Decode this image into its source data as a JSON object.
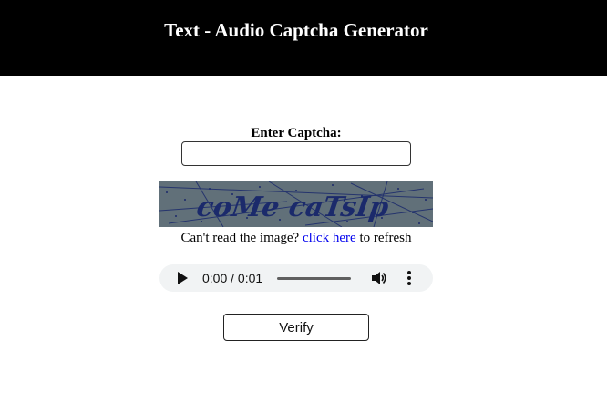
{
  "header": {
    "title": "Text - Audio Captcha Generator"
  },
  "form": {
    "label": "Enter Captcha:",
    "input_value": "",
    "captcha_text": "coMe caTsIp",
    "refresh_prefix": "Can't read the image? ",
    "refresh_link": "click here",
    "refresh_suffix": " to refresh",
    "verify_label": "Verify"
  },
  "audio": {
    "time": "0:00 / 0:01",
    "progress": 0
  },
  "colors": {
    "header_bg": "#000000",
    "captcha_bg": "#617079",
    "captcha_text": "#1b2a6b",
    "link": "#0000ee",
    "player_bg": "#f1f3f4"
  },
  "icons": {
    "play": "play-icon",
    "volume": "volume-icon",
    "menu": "more-vertical-icon"
  }
}
